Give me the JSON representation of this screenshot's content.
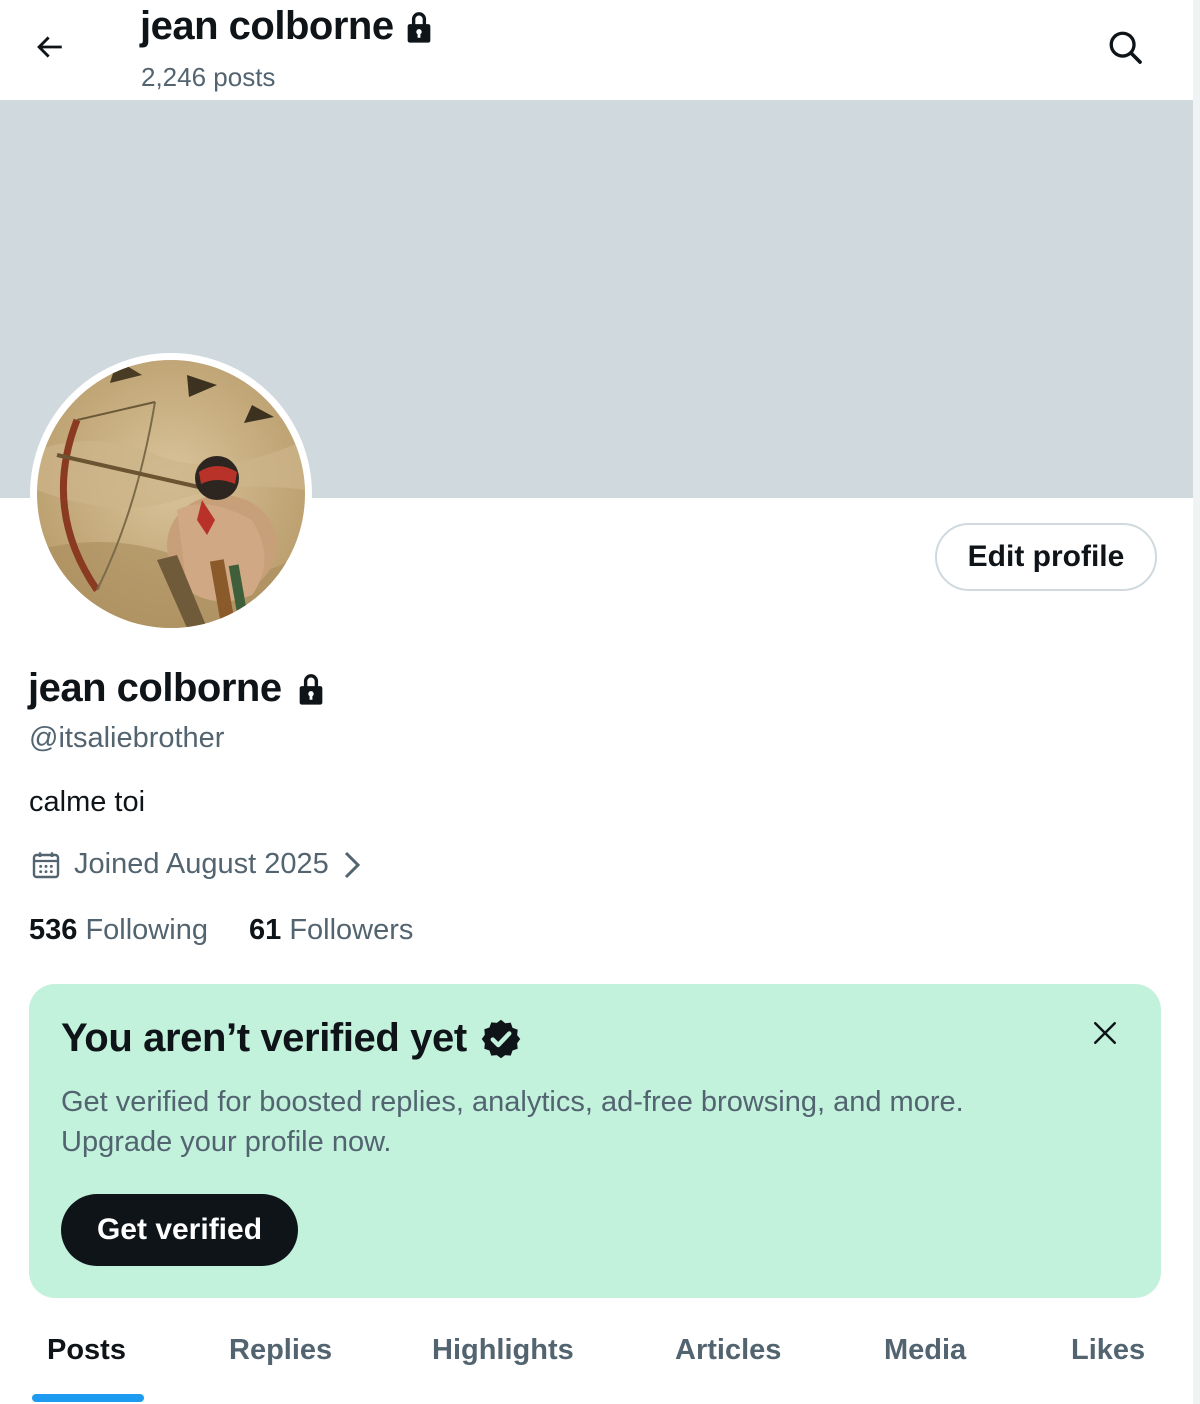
{
  "header": {
    "title": "jean colborne",
    "post_count": "2,246 posts",
    "back_icon": "arrow-left-icon",
    "search_icon": "search-icon",
    "lock_icon": "lock-icon"
  },
  "profile": {
    "display_name": "jean colborne",
    "handle": "@itsaliebrother",
    "bio": "calme toi",
    "joined": "Joined August 2025",
    "following_count": "536",
    "following_label": "Following",
    "followers_count": "61",
    "followers_label": "Followers",
    "edit_label": "Edit profile",
    "avatar_icon": "avatar-archer-painting",
    "banner_color": "#cfd9de"
  },
  "verify": {
    "title": "You aren’t verified yet",
    "description": "Get verified for boosted replies, analytics, ad-free browsing, and more. Upgrade your profile now.",
    "button_label": "Get verified",
    "badge_icon": "verified-badge-icon",
    "close_icon": "close-icon",
    "card_color": "#c2f1dc"
  },
  "tabs": [
    {
      "label": "Posts",
      "active": true
    },
    {
      "label": "Replies",
      "active": false
    },
    {
      "label": "Highlights",
      "active": false
    },
    {
      "label": "Articles",
      "active": false
    },
    {
      "label": "Media",
      "active": false
    },
    {
      "label": "Likes",
      "active": false
    }
  ],
  "colors": {
    "accent": "#1d9bf0",
    "text_primary": "#0f1419",
    "text_secondary": "#536471"
  }
}
